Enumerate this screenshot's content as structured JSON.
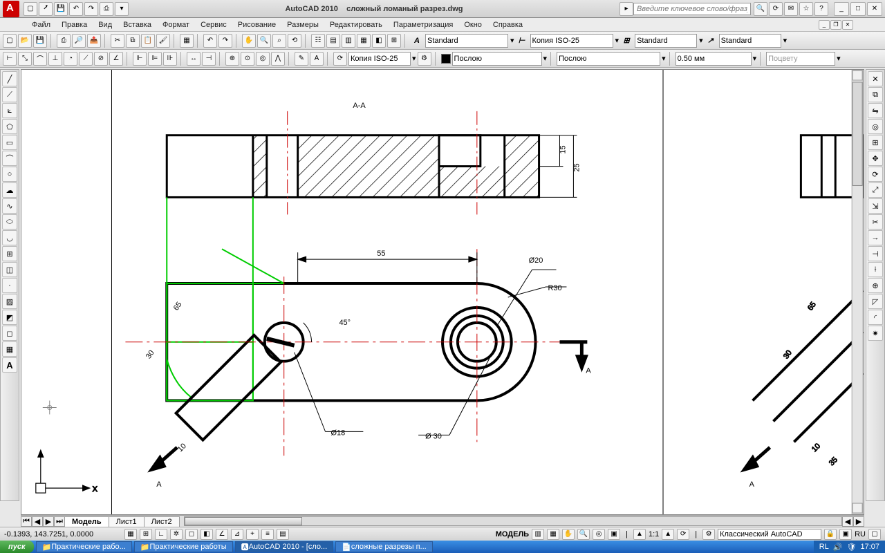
{
  "title": {
    "app": "AutoCAD 2010",
    "file": "сложный ломаный разрез.dwg"
  },
  "search": {
    "placeholder": "Введите ключевое слово/фразу"
  },
  "menu": [
    "Файл",
    "Правка",
    "Вид",
    "Вставка",
    "Формат",
    "Сервис",
    "Рисование",
    "Размеры",
    "Редактировать",
    "Параметризация",
    "Окно",
    "Справка"
  ],
  "style_combos": {
    "text_style": "Standard",
    "dim_style": "Копия ISO-25",
    "table_style": "Standard",
    "mleader_style": "Standard"
  },
  "props": {
    "dim_combo": "Копия ISO-25",
    "layer": "Послою",
    "linetype": "Послою",
    "lineweight": "0.50 мм",
    "color": "Поцвету"
  },
  "tabs": {
    "model": "Модель",
    "l1": "Лист1",
    "l2": "Лист2"
  },
  "status": {
    "coords": "-0.1393, 143.7251, 0.0000",
    "model": "МОДЕЛЬ",
    "scale": "1:1",
    "workspace": "Классический AutoCAD",
    "lang": "RU"
  },
  "taskbar": {
    "start": "пуск",
    "items": [
      "Практические рабо...",
      "Практические работы",
      "AutoCAD 2010 - [сло...",
      "сложные разрезы п..."
    ],
    "tray_lang": "RL",
    "clock": "17:07"
  },
  "drawing": {
    "section_label": "А-А",
    "dims": {
      "d55": "55",
      "d65": "65",
      "d30": "30",
      "d10": "10",
      "d15": "15",
      "d25": "25",
      "a45": "45°",
      "dia18": "Ø18",
      "dia20": "Ø20",
      "dia30": "Ø 30",
      "r30": "R30",
      "d35": "35"
    },
    "markA": "А"
  }
}
